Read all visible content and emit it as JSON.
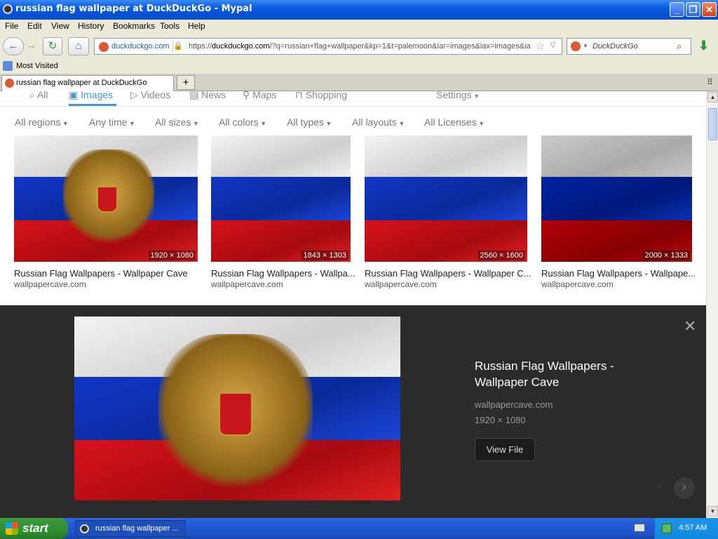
{
  "window": {
    "title": "russian flag wallpaper at DuckDuckGo - Mypal",
    "minimize": "_",
    "maximize": "❐",
    "close": "✕"
  },
  "menu": [
    "File",
    "Edit",
    "View",
    "History",
    "Bookmarks",
    "Tools",
    "Help"
  ],
  "nav": {
    "site_identity": "duckduckgo.com",
    "url_prefix": "https://",
    "url_domain": "duckduckgo.com",
    "url_rest": "/?q=russian+flag+wallpaper&kp=1&t=palemoon&iar=images&iax=images&ia",
    "search_placeholder": "DuckDuckGo"
  },
  "bookmarks": {
    "most_visited": "Most Visited"
  },
  "tabs": [
    {
      "label": "russian flag wallpaper at DuckDuckGo"
    }
  ],
  "search_tabs": {
    "all": "All",
    "images": "Images",
    "videos": "Videos",
    "news": "News",
    "maps": "Maps",
    "shopping": "Shopping",
    "settings": "Settings"
  },
  "filters": [
    "All regions",
    "Any time",
    "All sizes",
    "All colors",
    "All types",
    "All layouts",
    "All Licenses"
  ],
  "results": [
    {
      "title": "Russian Flag Wallpapers - Wallpaper Cave",
      "source": "wallpapercave.com",
      "dims": "1920 × 1080"
    },
    {
      "title": "Russian Flag Wallpapers - Wallpa...",
      "source": "wallpapercave.com",
      "dims": "1843 × 1303"
    },
    {
      "title": "Russian Flag Wallpapers - Wallpaper C...",
      "source": "wallpapercave.com",
      "dims": "2560 × 1600"
    },
    {
      "title": "Russian Flag Wallpapers - Wallpape...",
      "source": "wallpapercave.com",
      "dims": "2000 × 1333"
    }
  ],
  "detail": {
    "title": "Russian Flag Wallpapers - Wallpaper Cave",
    "source": "wallpapercave.com",
    "dims": "1920 × 1080",
    "view_file": "View File"
  },
  "taskbar": {
    "start": "start",
    "task": "russian flag wallpaper ...",
    "clock": "4:57 AM"
  },
  "colors": {
    "accent": "#4495d4",
    "flag_white": "#f4f4f4",
    "flag_blue": "#1136c6",
    "flag_red": "#d8121a",
    "xp_blue": "#245ddb",
    "xp_green": "#2f8f2f"
  }
}
